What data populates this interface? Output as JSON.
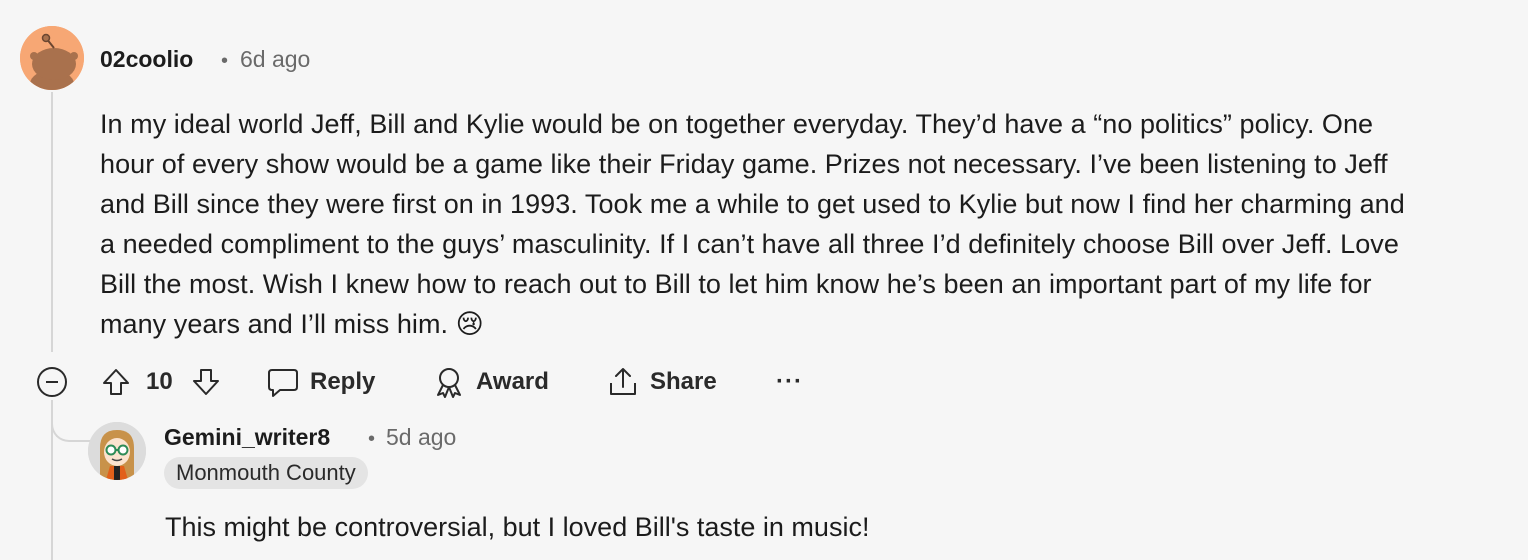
{
  "comment": {
    "author": "02coolio",
    "separator": "•",
    "time": "6d ago",
    "lines": [
      "In my ideal world Jeff, Bill and Kylie would be on together everyday. They’d have a “no politics” policy. One",
      "hour of every show would be a game like their Friday game. Prizes not necessary. I’ve been listening to Jeff",
      "and Bill since they were first on in 1993. Took me a while to get used to Kylie but now I find her charming and",
      "a needed compliment to the guys’ masculinity. If I can’t have all three I’d definitely choose Bill over Jeff. Love",
      "Bill the most. Wish I knew how to reach out to Bill to let him know he’s been an important part of my life for",
      "many years and I’ll miss him. 😢"
    ],
    "score": "10",
    "actions": {
      "reply": "Reply",
      "award": "Award",
      "share": "Share",
      "more": "···"
    },
    "icons": [
      "collapse-icon",
      "upvote-icon",
      "downvote-icon",
      "reply-icon",
      "award-icon",
      "share-icon",
      "more-icon"
    ]
  },
  "reply": {
    "author": "Gemini_writer8",
    "separator": "•",
    "time": "5d ago",
    "flair": "Monmouth County",
    "text": "This might be controversial, but I loved Bill's taste in music!"
  },
  "colors": {
    "background": "#f6f6f6",
    "text": "#1c1c1c",
    "muted": "#6a6a6a",
    "avatar_orange": "#f7a774",
    "flair_bg": "#e4e4e4"
  }
}
